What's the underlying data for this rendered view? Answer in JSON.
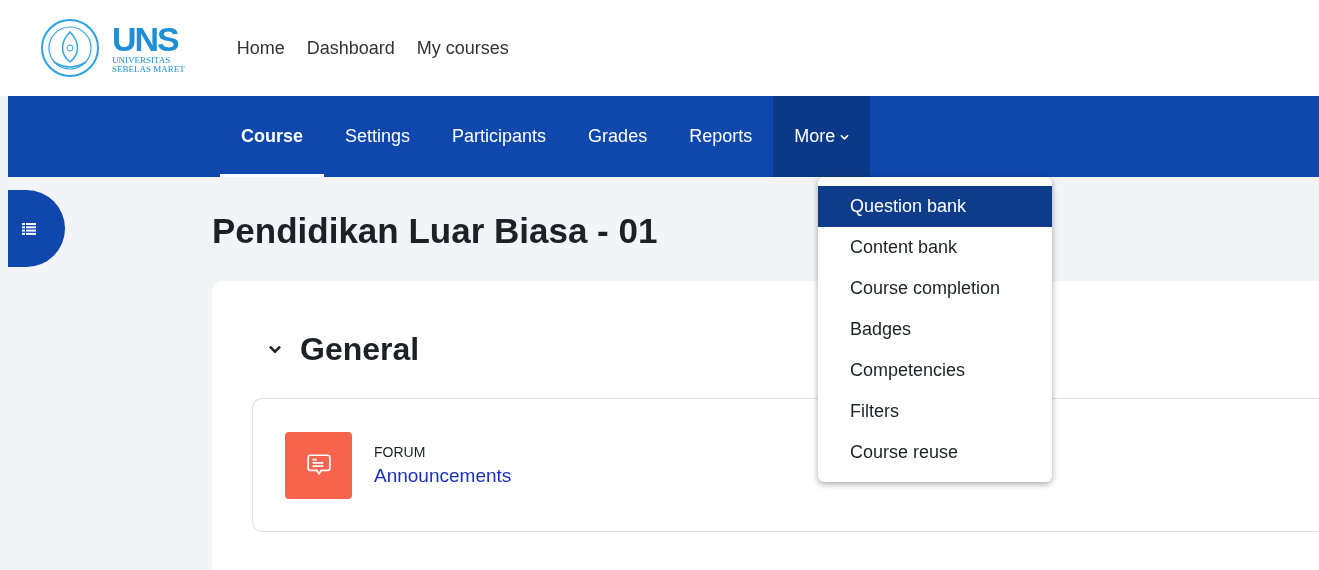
{
  "logo": {
    "abbr": "UNS",
    "line_1": "UNIVERSITAS",
    "line_2": "SEBELAS MARET"
  },
  "top_nav": [
    "Home",
    "Dashboard",
    "My courses"
  ],
  "course_nav": [
    {
      "label": "Course",
      "selected": true,
      "kind": "tab"
    },
    {
      "label": "Settings",
      "selected": false,
      "kind": "tab"
    },
    {
      "label": "Participants",
      "selected": false,
      "kind": "tab"
    },
    {
      "label": "Grades",
      "selected": false,
      "kind": "tab"
    },
    {
      "label": "Reports",
      "selected": false,
      "kind": "tab"
    },
    {
      "label": "More",
      "selected": false,
      "kind": "menu",
      "expanded": true
    }
  ],
  "more_menu": [
    {
      "label": "Question bank",
      "selected": true
    },
    {
      "label": "Content bank",
      "selected": false
    },
    {
      "label": "Course completion",
      "selected": false
    },
    {
      "label": "Badges",
      "selected": false
    },
    {
      "label": "Competencies",
      "selected": false
    },
    {
      "label": "Filters",
      "selected": false
    },
    {
      "label": "Course reuse",
      "selected": false
    }
  ],
  "course_title": "Pendidikan Luar Biasa - 01",
  "section": {
    "title": "General",
    "expanded": true,
    "activities": [
      {
        "type": "FORUM",
        "name": "Announcements"
      }
    ]
  }
}
